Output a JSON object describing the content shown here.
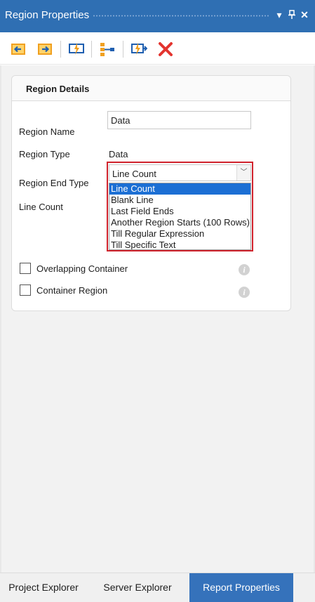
{
  "panel": {
    "title": "Region Properties",
    "dropdown_glyph": "▾",
    "pin_glyph": "₽",
    "close_glyph": "✕"
  },
  "toolbar": {
    "icons": [
      "arrow-left-icon",
      "arrow-right-icon",
      "lightning-icon",
      "hierarchy-icon",
      "lightning-arrow-icon",
      "delete-icon"
    ],
    "delete_color": "#e3342f",
    "accent": "#f0a020"
  },
  "details": {
    "header": "Region Details",
    "region_name_label": "Region Name",
    "region_name_value": "Data",
    "region_type_label": "Region Type",
    "region_type_value": "Data",
    "region_end_type_label": "Region End Type",
    "region_end_type_value": "Line Count",
    "combo_arrow": "﹀",
    "line_count_label": "Line Count",
    "options": [
      "Line Count",
      "Blank Line",
      "Last Field Ends",
      "Another Region Starts (100 Rows)",
      "Till Regular Expression",
      "Till Specific Text"
    ],
    "overlapping_container_label": "Overlapping Container",
    "container_region_label": "Container Region",
    "info_glyph": "i"
  },
  "tabs": [
    {
      "label": "Project Explorer",
      "active": false
    },
    {
      "label": "Server Explorer",
      "active": false
    },
    {
      "label": "Report Properties",
      "active": true
    }
  ],
  "colors": {
    "title_bar": "#2f6fb3",
    "selected_option": "#1c6fd4",
    "highlight_border": "#d0222c",
    "active_tab": "#3572bb"
  }
}
